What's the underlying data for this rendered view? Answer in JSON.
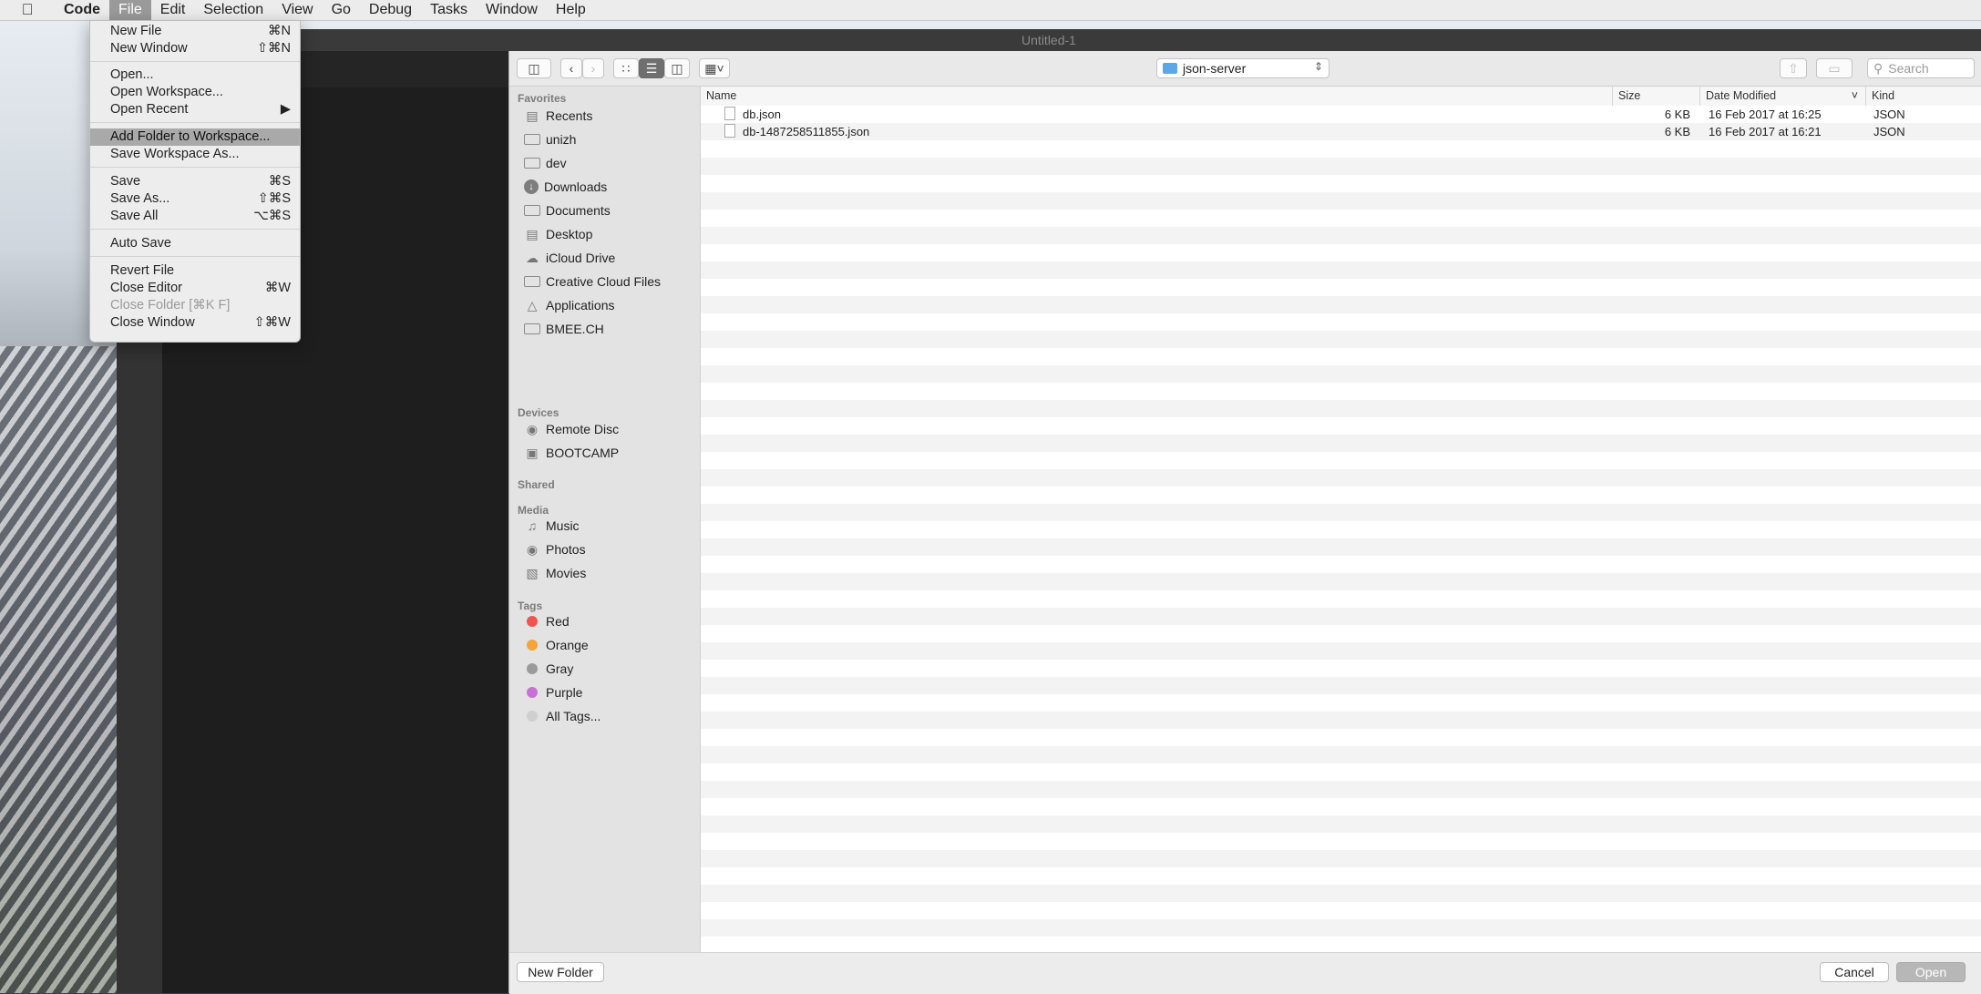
{
  "menubar": {
    "app_name": "Code",
    "items": [
      "File",
      "Edit",
      "Selection",
      "View",
      "Go",
      "Debug",
      "Tasks",
      "Window",
      "Help"
    ]
  },
  "editor": {
    "window_title": "Untitled-1"
  },
  "file_menu": {
    "items": [
      {
        "label": "New File",
        "shortcut": "⌘N"
      },
      {
        "label": "New Window",
        "shortcut": "⇧⌘N"
      },
      {
        "label": "Open...",
        "shortcut": ""
      },
      {
        "label": "Open Workspace...",
        "shortcut": ""
      },
      {
        "label": "Open Recent",
        "shortcut": "▶"
      },
      {
        "label": "Add Folder to Workspace...",
        "shortcut": ""
      },
      {
        "label": "Save Workspace As...",
        "shortcut": ""
      },
      {
        "label": "Save",
        "shortcut": "⌘S"
      },
      {
        "label": "Save As...",
        "shortcut": "⇧⌘S"
      },
      {
        "label": "Save All",
        "shortcut": "⌥⌘S"
      },
      {
        "label": "Auto Save",
        "shortcut": ""
      },
      {
        "label": "Revert File",
        "shortcut": ""
      },
      {
        "label": "Close Editor",
        "shortcut": "⌘W"
      },
      {
        "label": "Close Folder [⌘K F]",
        "shortcut": ""
      },
      {
        "label": "Close Window",
        "shortcut": "⇧⌘W"
      }
    ]
  },
  "dialog": {
    "location": "json-server",
    "search_placeholder": "Search",
    "sidebar": {
      "favorites_header": "Favorites",
      "favorites": [
        "Recents",
        "unizh",
        "dev",
        "Downloads",
        "Documents",
        "Desktop",
        "iCloud Drive",
        "Creative Cloud Files",
        "Applications",
        "BMEE.CH"
      ],
      "devices_header": "Devices",
      "devices": [
        "Remote Disc",
        "BOOTCAMP"
      ],
      "shared_header": "Shared",
      "media_header": "Media",
      "media": [
        "Music",
        "Photos",
        "Movies"
      ],
      "tags_header": "Tags",
      "tags": [
        {
          "label": "Red",
          "color": "#f0544f"
        },
        {
          "label": "Orange",
          "color": "#f5a33a"
        },
        {
          "label": "Gray",
          "color": "#9a9a9a"
        },
        {
          "label": "Purple",
          "color": "#c96fd8"
        },
        {
          "label": "All Tags...",
          "color": "#cfcfcf"
        }
      ]
    },
    "columns": [
      "Name",
      "Size",
      "Date Modified",
      "Kind"
    ],
    "files": [
      {
        "name": "db.json",
        "size": "6 KB",
        "modified": "16 Feb 2017 at 16:25",
        "kind": "JSON"
      },
      {
        "name": "db-1487258511855.json",
        "size": "6 KB",
        "modified": "16 Feb 2017 at 16:21",
        "kind": "JSON"
      }
    ],
    "new_folder_label": "New Folder",
    "cancel_label": "Cancel",
    "open_label": "Open"
  }
}
